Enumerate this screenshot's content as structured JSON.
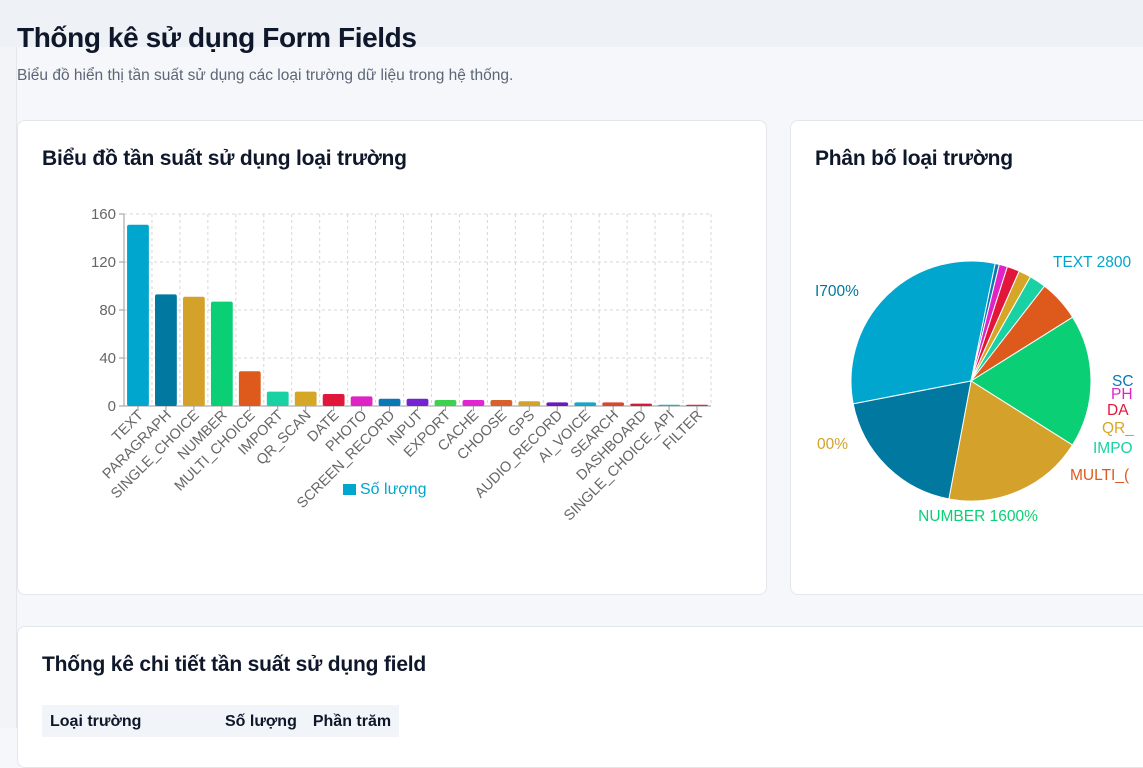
{
  "page": {
    "title": "Thống kê sử dụng Form Fields",
    "description": "Biểu đồ hiển thị tần suất sử dụng các loại trường dữ liệu trong hệ thống."
  },
  "bar_card": {
    "title": "Biểu đồ tần suất sử dụng loại trường"
  },
  "pie_card": {
    "title": "Phân bố loại trường"
  },
  "table_card": {
    "title": "Thống kê chi tiết tần suất sử dụng field",
    "columns": [
      "Loại trường",
      "Số lượng",
      "Phần trăm"
    ]
  },
  "colors": {
    "TEXT": "#00a6cd",
    "PARAGRAPH": "#0078a0",
    "SINGLE_CHOICE": "#d4a12a",
    "NUMBER": "#0bcf74",
    "MULTI_CHOICE": "#dd5a1c",
    "IMPORT": "#19d1a3",
    "QR_SCAN": "#d6a727",
    "DATE": "#e0173a",
    "PHOTO": "#de24c4",
    "SCREEN_RECORD": "#0a78b5",
    "INPUT": "#7422d2",
    "EXPORT": "#3dd14f",
    "CACHE": "#e225d3",
    "CHOOSE": "#d9602b",
    "GPS": "#d4a12a",
    "AUDIO_RECORD": "#6a1bbd",
    "AI_VOICE": "#11a8c9",
    "SEARCH": "#d8492c",
    "DASHBOARD": "#d31b38",
    "SINGLE_CHOICE_API": "#12b6c6",
    "FILTER": "#dd2d3c"
  },
  "chart_data": [
    {
      "type": "bar",
      "categories": [
        "TEXT",
        "PARAGRAPH",
        "SINGLE_CHOICE",
        "NUMBER",
        "MULTI_CHOICE",
        "IMPORT",
        "QR_SCAN",
        "DATE",
        "PHOTO",
        "SCREEN_RECORD",
        "INPUT",
        "EXPORT",
        "CACHE",
        "CHOOSE",
        "GPS",
        "AUDIO_RECORD",
        "AI_VOICE",
        "SEARCH",
        "DASHBOARD",
        "SINGLE_CHOICE_API",
        "FILTER"
      ],
      "series": [
        {
          "name": "Số lượng",
          "values": [
            151,
            93,
            91,
            87,
            29,
            12,
            12,
            10,
            8,
            6,
            6,
            5,
            5,
            5,
            4,
            3,
            3,
            3,
            2,
            1,
            1
          ]
        }
      ],
      "ylim": [
        0,
        160
      ],
      "yticks": [
        0,
        40,
        80,
        120,
        160
      ],
      "grid": true,
      "legend": "bottom"
    },
    {
      "type": "pie",
      "labels": [
        "TEXT",
        "SCREEN_RECORD",
        "PHOTO",
        "DATE",
        "QR_SCAN",
        "IMPORT",
        "MULTI_CHOICE",
        "NUMBER",
        "SINGLE_CHOICE",
        "PARAGRAPH"
      ],
      "values": [
        28,
        0.5,
        1,
        1.5,
        1.5,
        2,
        5,
        16,
        17,
        17
      ],
      "visible_labels": [
        "TEXT 2800",
        "SC",
        "PH",
        "DA",
        "QR_",
        "IMPO",
        "MULTI_(",
        "NUMBER 1600%",
        "00%",
        "I700%"
      ]
    }
  ]
}
